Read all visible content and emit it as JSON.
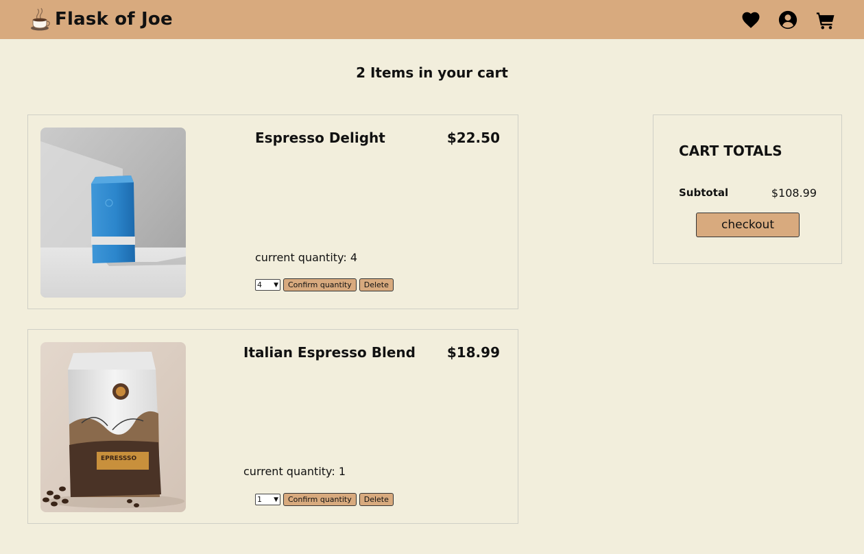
{
  "app": {
    "title": "Flask of Joe",
    "brand_color": "#d8aa7e",
    "background_color": "#f2eedc",
    "logo_icon": "coffee-cup-icon"
  },
  "nav": {
    "icons": [
      "heart-icon",
      "user-circle-icon",
      "cart-icon"
    ]
  },
  "cart": {
    "heading": "2 Items in your cart",
    "items": [
      {
        "name": "Espresso Delight",
        "price": "$22.50",
        "quantity_label": "current quantity: 4",
        "selected_quantity": "4",
        "confirm_label": "Confirm quantity",
        "delete_label": "Delete",
        "image": "blue-coffee-bag"
      },
      {
        "name": "Italian Espresso Blend",
        "price": "$18.99",
        "quantity_label": "current quantity: 1",
        "selected_quantity": "1",
        "confirm_label": "Confirm quantity",
        "delete_label": "Delete",
        "image": "espresso-coffee-bag",
        "bag_label": "EPRESSSO"
      }
    ]
  },
  "totals": {
    "title": "CART TOTALS",
    "subtotal_label": "Subtotal",
    "subtotal_value": "$108.99",
    "checkout_label": "checkout"
  }
}
